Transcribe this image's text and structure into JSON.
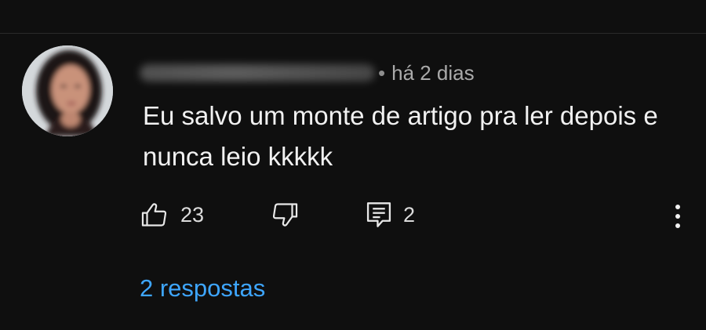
{
  "comment": {
    "author_handle": "@••••••••••••••••••",
    "separator": "•",
    "timestamp": "há 2 dias",
    "text": "Eu salvo um monte de artigo pra ler depois e nunca leio kkkkk",
    "avatar_icon": "user-avatar-photo"
  },
  "actions": {
    "like_icon": "thumbs-up-icon",
    "like_count": "23",
    "dislike_icon": "thumbs-down-icon",
    "reply_icon": "comment-reply-icon",
    "reply_count": "2",
    "more_icon": "more-vert-icon"
  },
  "replies": {
    "label": "2 respostas"
  },
  "colors": {
    "background": "#0f0f0f",
    "text": "#f1f1f1",
    "meta": "#aaaaaa",
    "link": "#3ea6ff"
  }
}
